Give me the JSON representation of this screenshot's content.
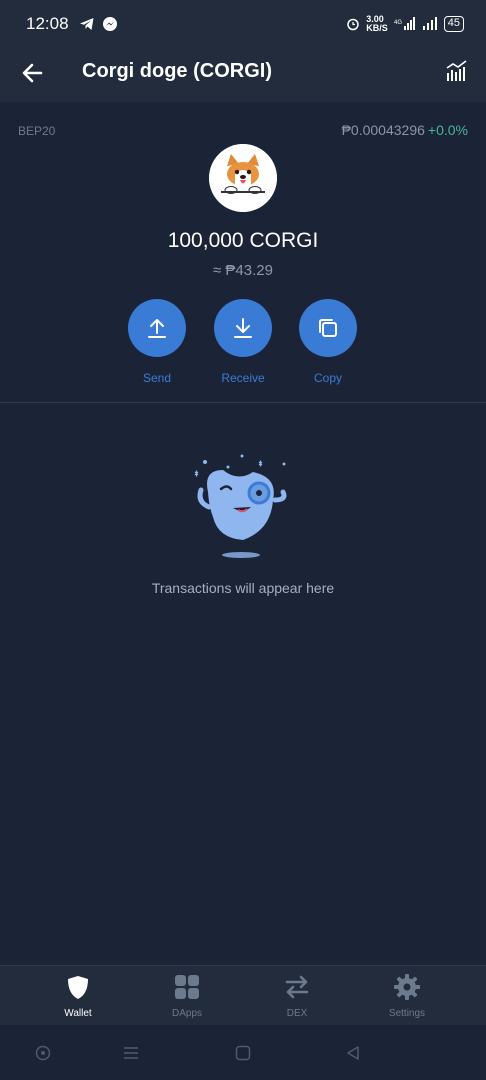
{
  "status_bar": {
    "time": "12:08",
    "speed": "3.00\nKB/S",
    "battery": "45",
    "icons": [
      "telegram-icon",
      "messenger-icon",
      "alarm-icon",
      "4g-signal-icon",
      "signal-icon",
      "battery-icon"
    ]
  },
  "header": {
    "title": "Corgi doge (CORGI)",
    "back_icon": "arrow-left-icon",
    "chart_icon": "chart-icon"
  },
  "token": {
    "network": "BEP20",
    "price": "₱0.00043296",
    "change": "+0.0%",
    "balance": "100,000 CORGI",
    "fiat": "≈ ₱43.29"
  },
  "actions": [
    {
      "label": "Send",
      "icon": "upload-icon"
    },
    {
      "label": "Receive",
      "icon": "download-icon"
    },
    {
      "label": "Copy",
      "icon": "copy-icon"
    }
  ],
  "empty_state": {
    "message": "Transactions will appear here"
  },
  "bottom_nav": [
    {
      "label": "Wallet",
      "icon": "shield-icon",
      "active": true
    },
    {
      "label": "DApps",
      "icon": "grid-icon",
      "active": false
    },
    {
      "label": "DEX",
      "icon": "swap-icon",
      "active": false
    },
    {
      "label": "Settings",
      "icon": "gear-icon",
      "active": false
    }
  ],
  "colors": {
    "background": "#1b2436",
    "header": "#222c3d",
    "accent": "#3a7bd5",
    "positive": "#4ab49a"
  }
}
